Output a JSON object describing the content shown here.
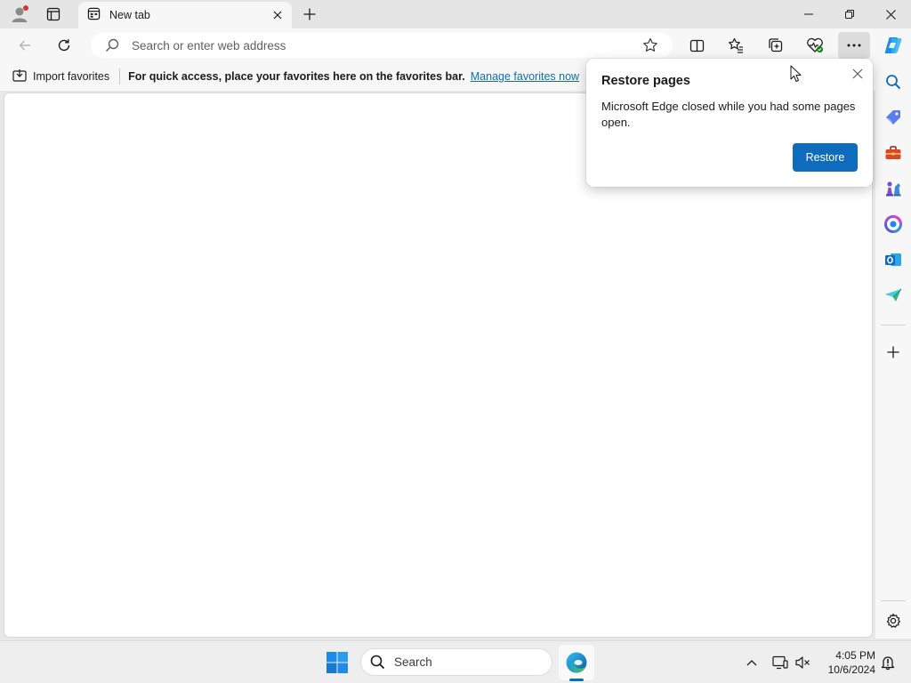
{
  "window": {
    "tab_title": "New tab"
  },
  "toolbar": {
    "address_placeholder": "Search or enter web address"
  },
  "favorites_bar": {
    "import_label": "Import favorites",
    "message": "For quick access, place your favorites here on the favorites bar.",
    "link": "Manage favorites now"
  },
  "popup": {
    "title": "Restore pages",
    "body": "Microsoft Edge closed while you had some pages open.",
    "restore_label": "Restore"
  },
  "taskbar": {
    "search_label": "Search",
    "time": "4:05 PM",
    "date": "10/6/2024"
  },
  "colors": {
    "accent": "#0f6cbd",
    "chrome": "#f7f7f7",
    "tab_strip": "#e5e5e5"
  }
}
